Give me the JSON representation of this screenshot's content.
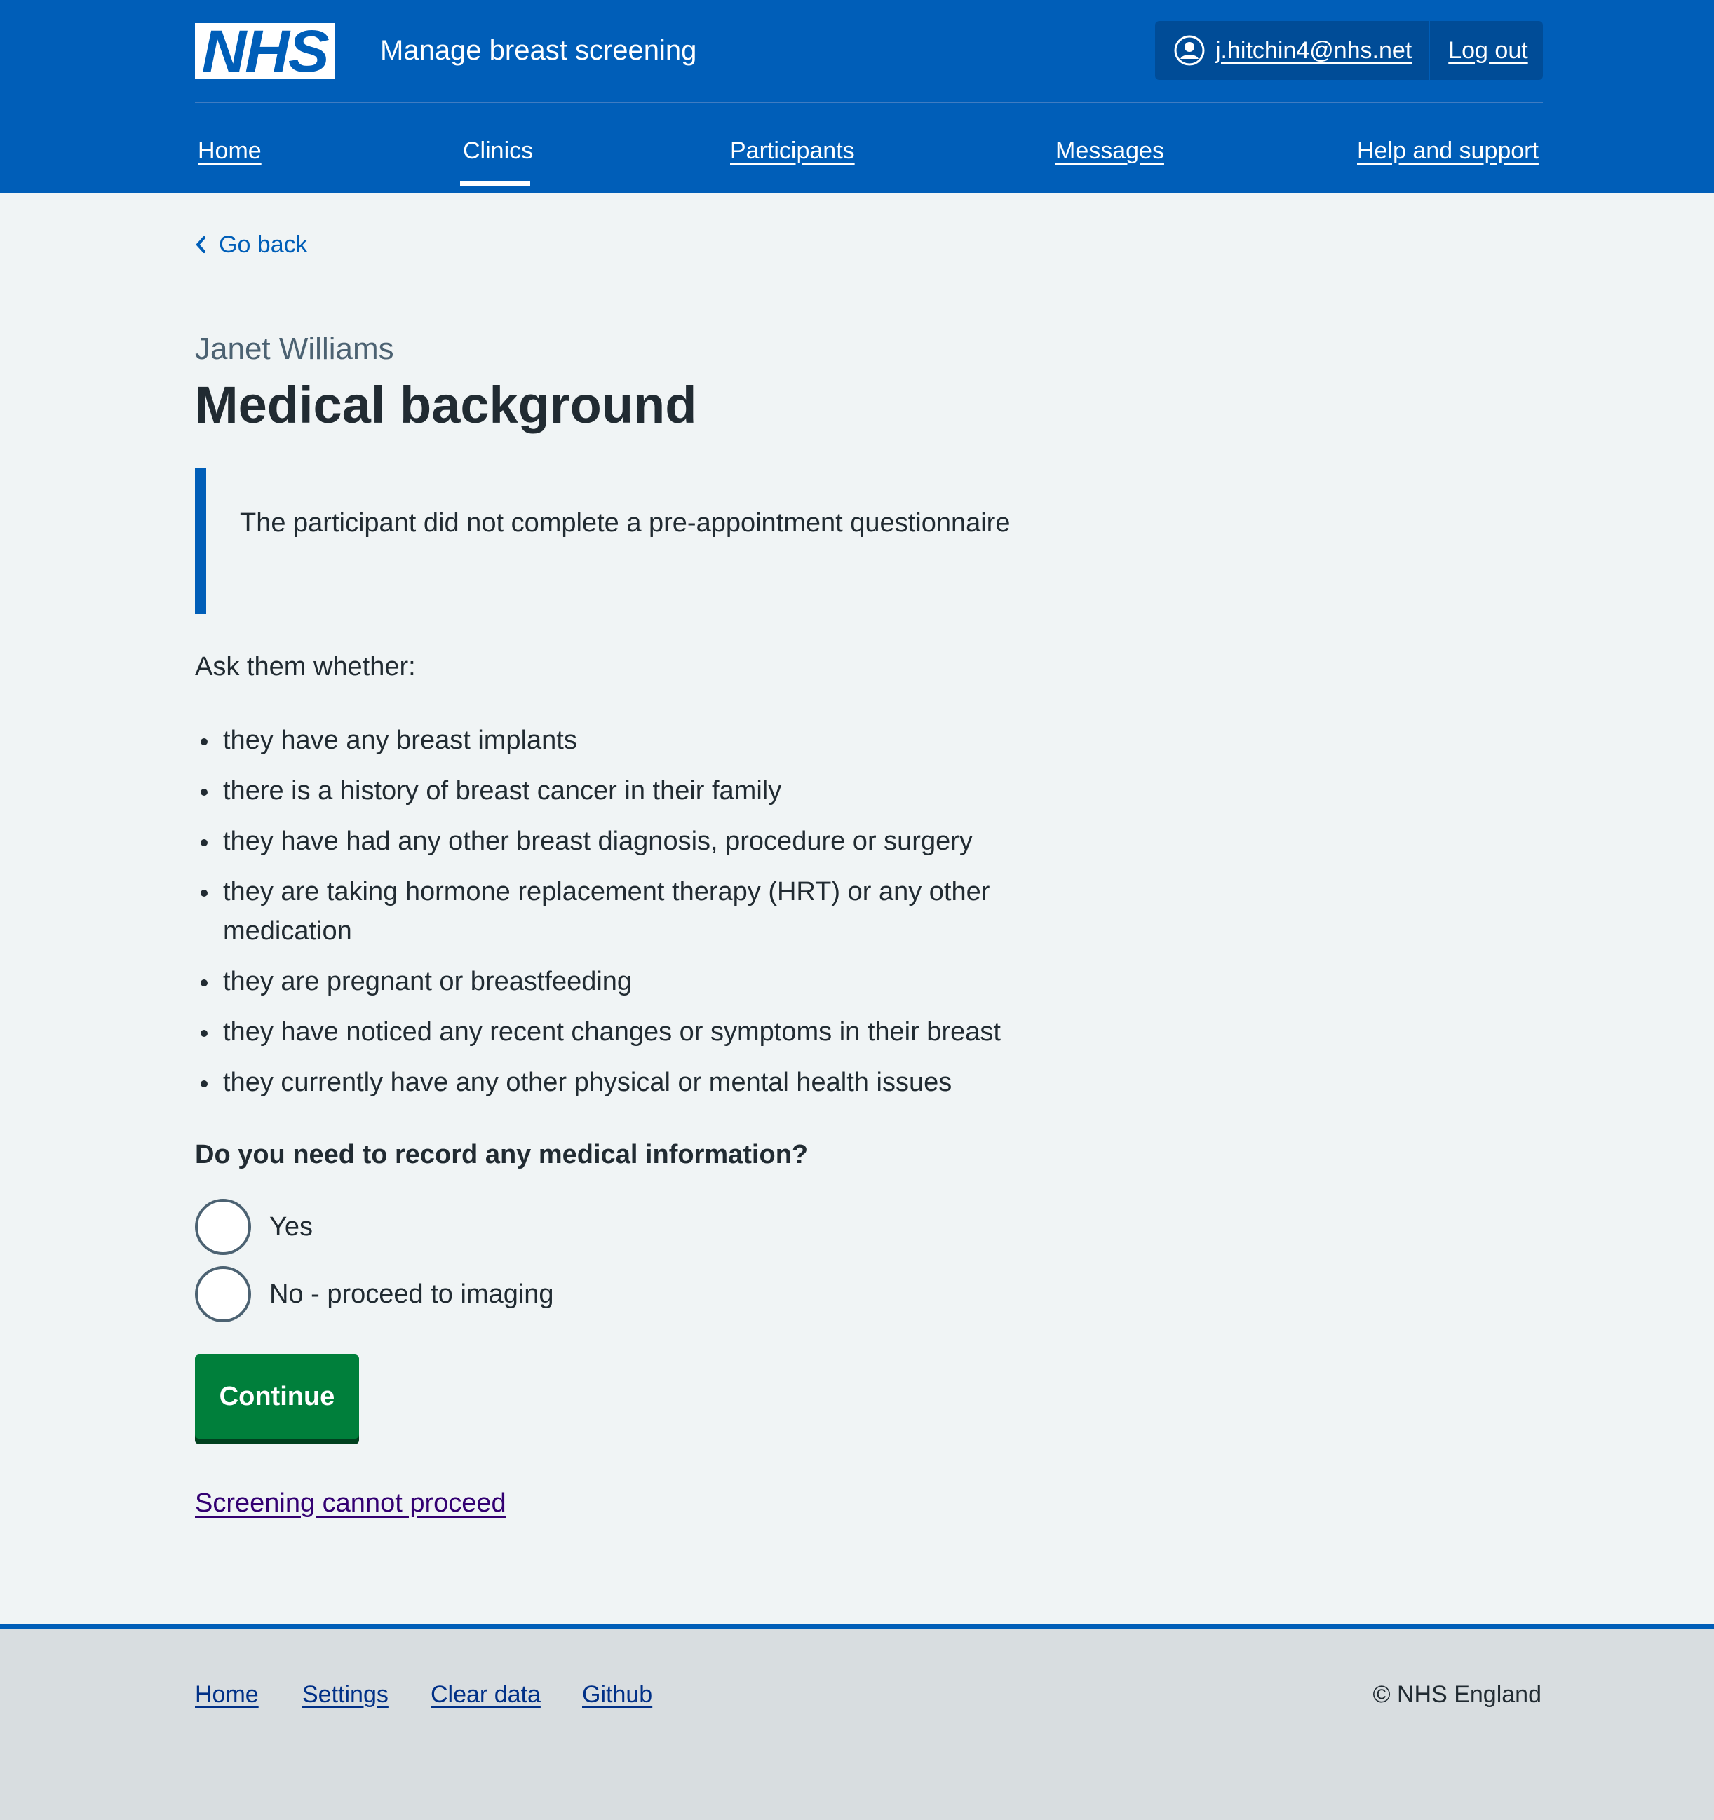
{
  "header": {
    "logo_text": "NHS",
    "service_name": "Manage breast screening",
    "account": {
      "user_email": "j.hitchin4@nhs.net",
      "logout_label": "Log out"
    },
    "nav": [
      {
        "label": "Home"
      },
      {
        "label": "Clinics",
        "current": true
      },
      {
        "label": "Participants"
      },
      {
        "label": "Messages"
      },
      {
        "label": "Help and support"
      }
    ]
  },
  "back_link": "Go back",
  "page": {
    "caption": "Janet Williams",
    "title": "Medical background",
    "inset_text": "The participant did not complete a pre-appointment questionnaire",
    "lead": "Ask them whether:",
    "bullets": [
      "they have any breast implants",
      "there is a history of breast cancer in their family",
      "they have had any other breast diagnosis, procedure or surgery",
      "they are taking hormone replacement therapy (HRT) or any other medication",
      "they are pregnant or breastfeeding",
      "they have noticed any recent changes or symptoms in their breast",
      "they currently have any other physical or mental health issues"
    ],
    "question": "Do you need to record any medical information?",
    "options": [
      {
        "label": "Yes",
        "selected": false
      },
      {
        "label": "No - proceed to imaging",
        "selected": false
      }
    ],
    "continue_label": "Continue",
    "secondary_link": "Screening cannot proceed"
  },
  "footer": {
    "links": [
      "Home",
      "Settings",
      "Clear data",
      "Github"
    ],
    "copyright": "© NHS England"
  },
  "colors": {
    "brand_blue": "#005eb8",
    "dark_blue": "#004c97",
    "button_green": "#007f3b",
    "visited_link": "#330072",
    "page_background": "#f0f4f5",
    "footer_background": "#d8dde0"
  },
  "icons": {
    "account": "user-icon",
    "back": "chevron-left-icon"
  }
}
